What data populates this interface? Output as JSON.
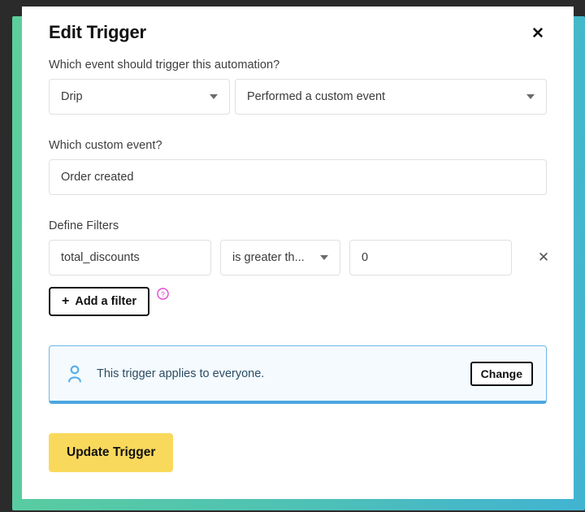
{
  "modal": {
    "title": "Edit Trigger",
    "close_label": "✕"
  },
  "event_section": {
    "label": "Which event should trigger this automation?",
    "source_select": {
      "value": "Drip",
      "icon": "chevron-down-icon"
    },
    "event_select": {
      "value": "Performed a custom event",
      "icon": "chevron-down-icon"
    }
  },
  "custom_event_section": {
    "label": "Which custom event?",
    "value": "Order created"
  },
  "filters_section": {
    "label": "Define Filters",
    "rows": [
      {
        "field": "total_discounts",
        "operator": "is greater th...",
        "value": "0",
        "remove_label": "✕"
      }
    ],
    "add_filter_label": "Add a filter",
    "add_filter_plus": "+",
    "help_icon": "help-circle-icon"
  },
  "notice": {
    "icon": "person-icon",
    "text": "This trigger applies to everyone.",
    "change_label": "Change"
  },
  "footer": {
    "submit_label": "Update Trigger"
  },
  "colors": {
    "accent_yellow": "#f9d95c",
    "notice_blue": "#4da6e0",
    "notice_bg": "#f4fafe",
    "help_pink": "#e040d0",
    "gradient_start": "#5ccf9b",
    "gradient_end": "#41b4d2",
    "backdrop": "#2b2b2b"
  }
}
